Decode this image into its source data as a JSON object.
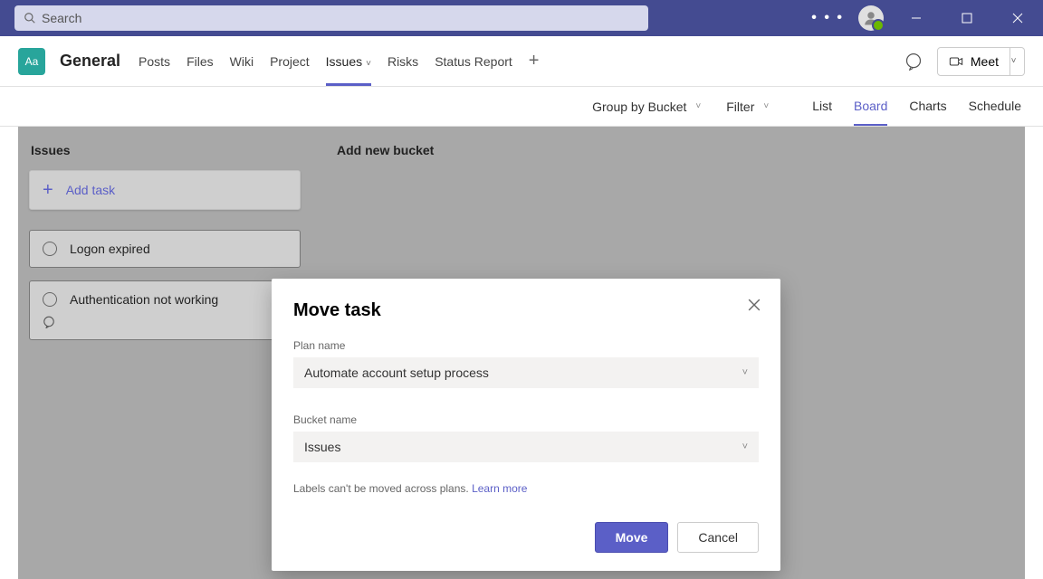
{
  "titlebar": {
    "search_placeholder": "Search"
  },
  "channel": {
    "icon_text": "Aa",
    "name": "General",
    "tabs": [
      "Posts",
      "Files",
      "Wiki",
      "Project",
      "Issues",
      "Risks",
      "Status Report"
    ],
    "active_tab_index": 4,
    "meet_label": "Meet"
  },
  "filterbar": {
    "group_label": "Group by Bucket",
    "filter_label": "Filter",
    "views": [
      "List",
      "Board",
      "Charts",
      "Schedule"
    ],
    "active_view_index": 1
  },
  "board": {
    "bucket_title": "Issues",
    "add_task_label": "Add task",
    "add_bucket_label": "Add new bucket",
    "cards": [
      {
        "title": "Logon expired",
        "has_comments": false
      },
      {
        "title": "Authentication not working",
        "has_comments": true
      }
    ]
  },
  "modal": {
    "title": "Move task",
    "plan_label": "Plan name",
    "plan_value": "Automate account setup process",
    "bucket_label": "Bucket name",
    "bucket_value": "Issues",
    "note_text": "Labels can't be moved across plans. ",
    "learn_more": "Learn more",
    "move_label": "Move",
    "cancel_label": "Cancel"
  }
}
